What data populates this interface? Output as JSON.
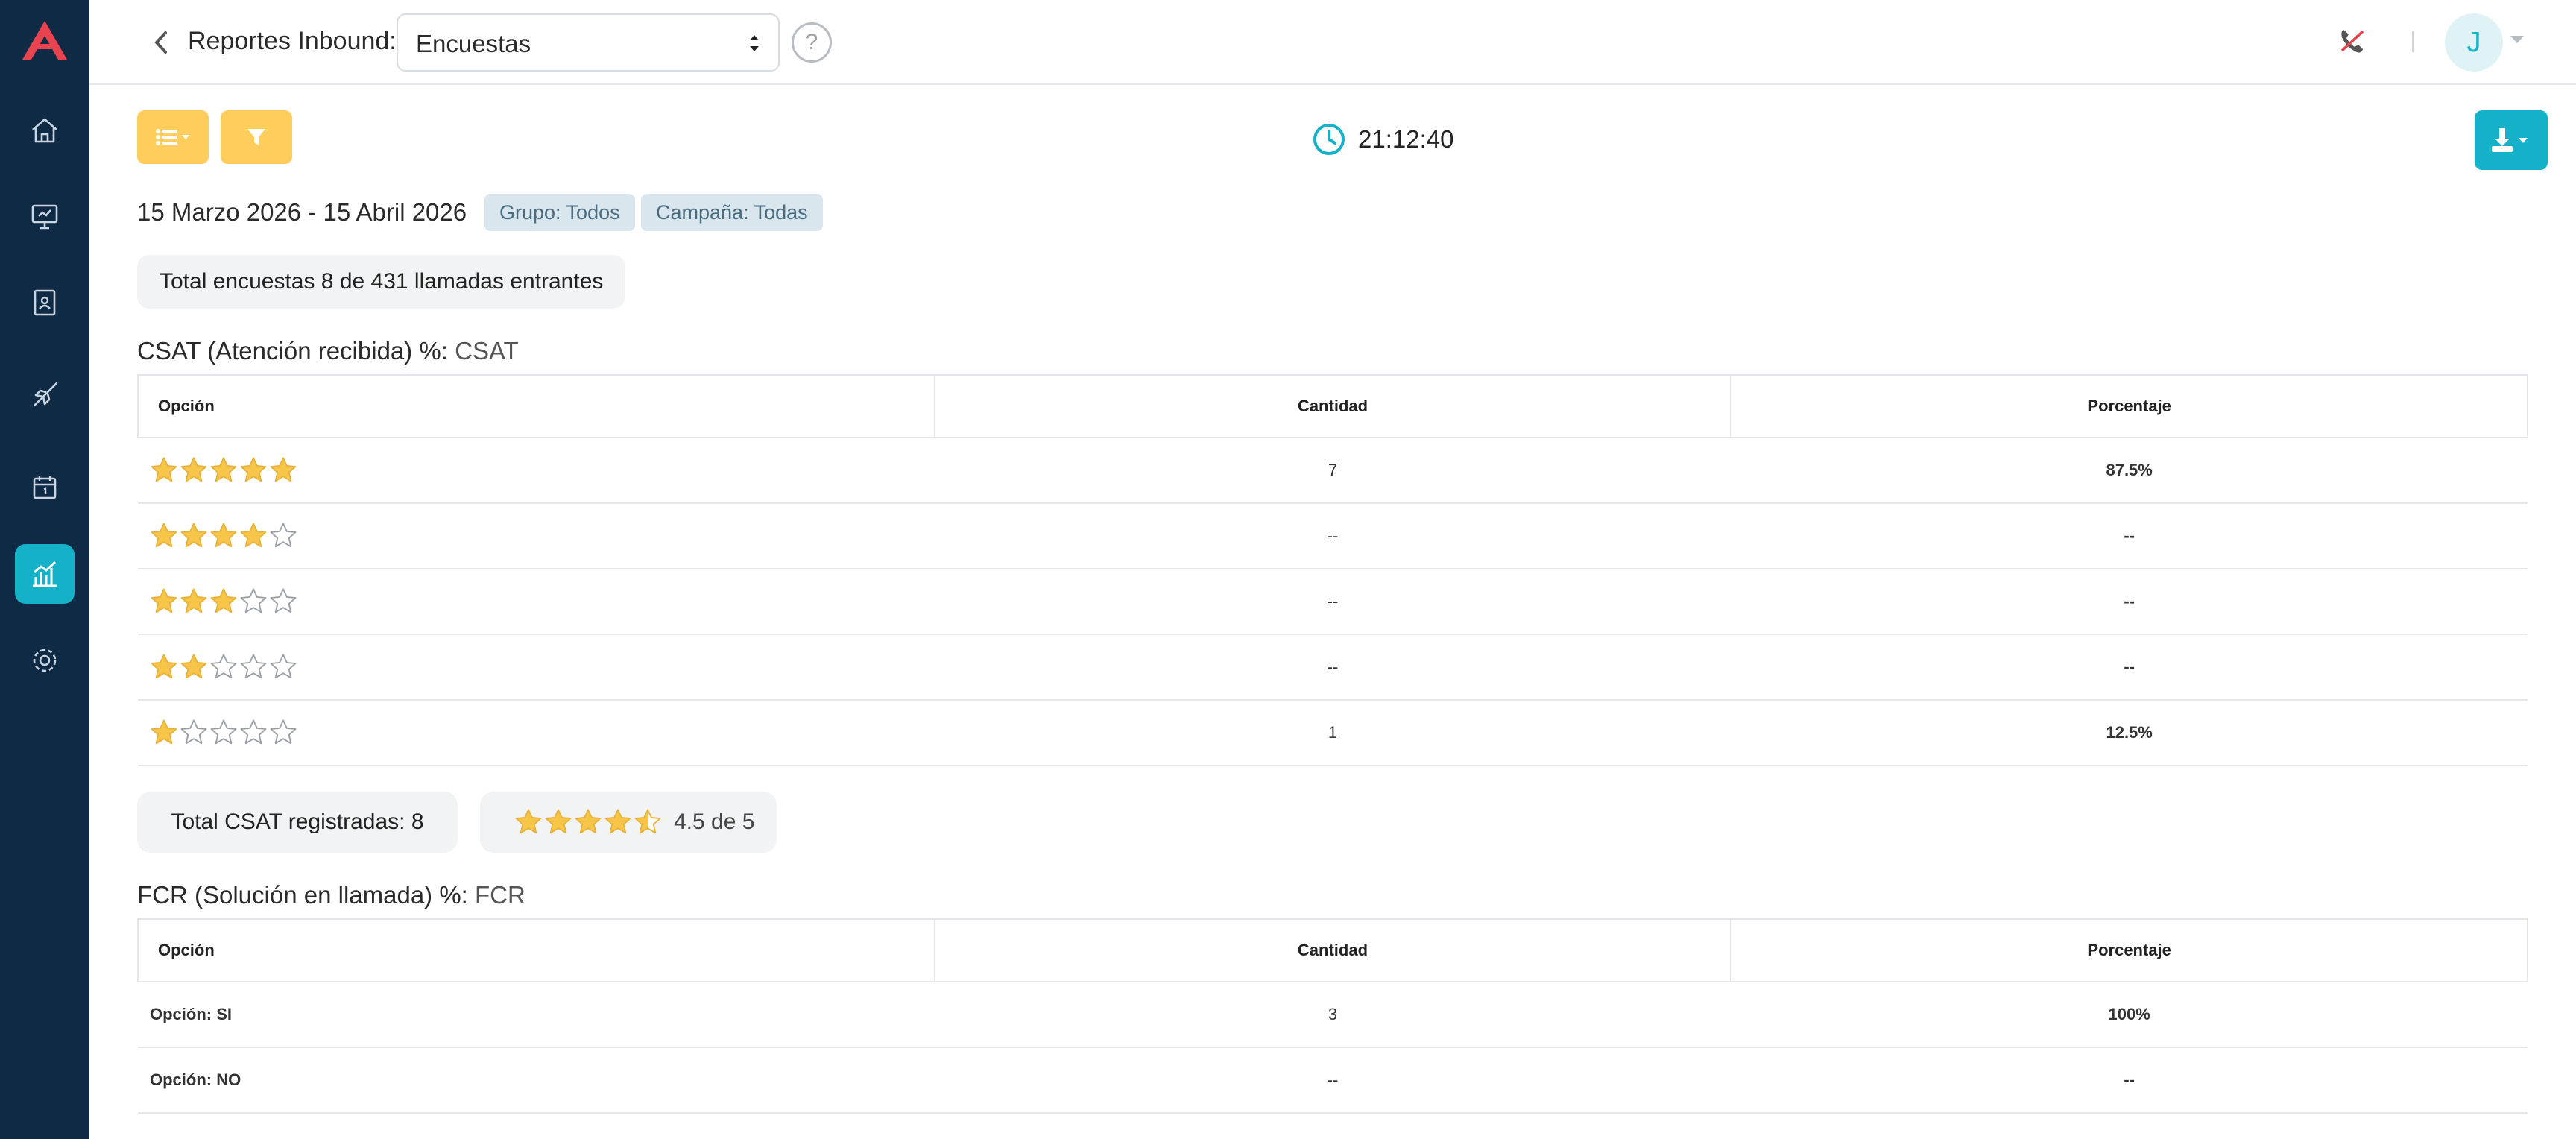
{
  "header": {
    "title": "Reportes Inbound:",
    "report_select": "Encuestas",
    "help": "?",
    "avatar": "J"
  },
  "toolbar": {
    "time": "21:12:40"
  },
  "filters": {
    "date_range": "15 Marzo 2026 - 15 Abril 2026",
    "group_chip": "Grupo: Todos",
    "campaign_chip": "Campaña: Todas"
  },
  "total_surveys": "Total encuestas 8 de 431 llamadas entrantes",
  "csat": {
    "title": "CSAT (Atención recibida) %:",
    "title_sub": "CSAT",
    "headers": [
      "Opción",
      "Cantidad",
      "Porcentaje"
    ],
    "rows": [
      {
        "stars": 5,
        "cantidad": "7",
        "porcentaje": "87.5%"
      },
      {
        "stars": 4,
        "cantidad": "--",
        "porcentaje": "--"
      },
      {
        "stars": 3,
        "cantidad": "--",
        "porcentaje": "--"
      },
      {
        "stars": 2,
        "cantidad": "--",
        "porcentaje": "--"
      },
      {
        "stars": 1,
        "cantidad": "1",
        "porcentaje": "12.5%"
      }
    ],
    "total_label": "Total CSAT registradas: 8",
    "average_stars": 4.5,
    "average_label": "4.5 de 5"
  },
  "fcr": {
    "title": "FCR (Solución en llamada) %:",
    "title_sub": "FCR",
    "headers": [
      "Opción",
      "Cantidad",
      "Porcentaje"
    ],
    "rows": [
      {
        "opcion": "Opción: SI",
        "cantidad": "3",
        "porcentaje": "100%"
      },
      {
        "opcion": "Opción: NO",
        "cantidad": "--",
        "porcentaje": "--"
      }
    ]
  },
  "colors": {
    "sidebar": "#0f2a44",
    "accent": "#14b1c8",
    "yellow": "#ffcd5c",
    "star": "#f7c548",
    "brand_red": "#e8434f"
  },
  "sidebar_icons": [
    "home-icon",
    "monitor-icon",
    "contacts-book-icon",
    "campaign-rocket-icon",
    "calendar-icon",
    "reports-chart-icon",
    "settings-gear-icon"
  ]
}
